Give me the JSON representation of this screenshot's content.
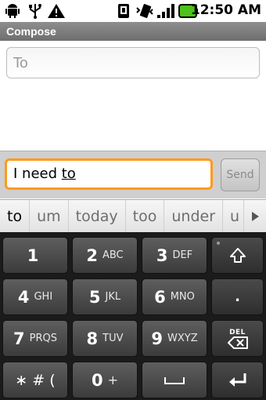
{
  "status_bar": {
    "time": "12:50 AM",
    "icons": [
      "android-icon",
      "usb-icon",
      "warning-icon",
      "sim-icon",
      "vibrate-icon",
      "signal-icon",
      "battery-icon"
    ]
  },
  "title_bar": {
    "title": "Compose"
  },
  "to_field": {
    "placeholder": "To"
  },
  "compose": {
    "message_prefix": "I need ",
    "message_word": "to",
    "send_label": "Send"
  },
  "suggestions": [
    "to",
    "um",
    "today",
    "too",
    "under",
    "u"
  ],
  "keyboard": {
    "row1": [
      {
        "digit": "1",
        "letters": ""
      },
      {
        "digit": "2",
        "letters": "ABC"
      },
      {
        "digit": "3",
        "letters": "DEF"
      }
    ],
    "row2": [
      {
        "digit": "4",
        "letters": "GHI"
      },
      {
        "digit": "5",
        "letters": "JKL"
      },
      {
        "digit": "6",
        "letters": "MNO"
      }
    ],
    "row3": [
      {
        "digit": "7",
        "letters": "PRQS"
      },
      {
        "digit": "8",
        "letters": "TUV"
      },
      {
        "digit": "9",
        "letters": "WXYZ"
      }
    ],
    "row4": [
      {
        "digit": "∗ # (",
        "letters": ""
      },
      {
        "digit": "0",
        "letters": "+"
      }
    ],
    "period_label": ".",
    "del_label": "DEL",
    "colors": {
      "accent": "#ff9a1a",
      "key": "#4a4a4a"
    }
  }
}
